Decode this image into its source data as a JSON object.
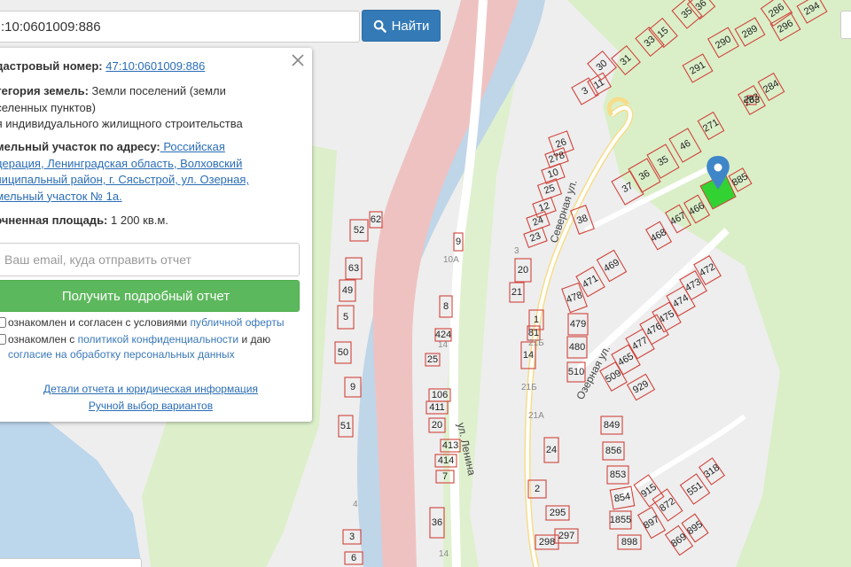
{
  "search": {
    "value": ":10:0601009:886",
    "button_label": "Найти"
  },
  "panel": {
    "cadastral_label": "адастровый номер:",
    "cadastral_value": "47:10:0601009:886",
    "category_label": "атегория земель:",
    "category_line1": " Земли поселений (земли",
    "category_line2": "аселенных пунктов)",
    "category_line3": "ля индивидуального жилищного строительства",
    "address_label": "емельный участок по адресу:",
    "address_line1": " Российская",
    "address_line2": "едерация, Ленинградская область, Волховский",
    "address_line3": "униципальный район, г. Сясьстрой, ул. Озерная,",
    "address_line4": "емельный участок № 1а.",
    "area_label": "точненная площадь:",
    "area_value": " 1 200 кв.м.",
    "email_placeholder": "Ваш email, куда отправить отчет",
    "report_button": "Получить подробный отчет",
    "consent1_prefix": "ознакомлен и согласен с условиями ",
    "consent1_link": "публичной оферты",
    "consent2_prefix": "ознакомлен с ",
    "consent2_link": "политикой конфиденциальности",
    "consent2_suffix": " и даю",
    "consent2_link2": "согласие на обработку персональных данных",
    "details_link": "Детали отчета и юридическая информация",
    "manual_link": "Ручной выбор вариантов"
  },
  "map": {
    "street_labels": [
      "Северная ул.",
      "Озерная ул.",
      "ул. Ленина"
    ],
    "faint_labels": [
      "21Б",
      "21А",
      "21Б",
      "10А",
      "14",
      "4",
      "3",
      "14"
    ],
    "parcel_labels": [
      "35",
      "36",
      "286",
      "294",
      "15",
      "33",
      "31",
      "30",
      "11",
      "290",
      "289",
      "291",
      "296",
      "3",
      "283",
      "284",
      "283",
      "271",
      "26",
      "278",
      "10",
      "25",
      "46",
      "35",
      "36",
      "37",
      "885",
      "12",
      "24",
      "23",
      "38",
      "467",
      "466",
      "468",
      "469",
      "472",
      "473",
      "62",
      "52",
      "63",
      "49",
      "9",
      "20",
      "21",
      "471",
      "478",
      "474",
      "475",
      "5",
      "8",
      "424",
      "479",
      "480",
      "476",
      "477",
      "465",
      "50",
      "25",
      "1",
      "14",
      "81",
      "510",
      "509",
      "929",
      "9",
      "106",
      "411",
      "413",
      "20",
      "51",
      "414",
      "7",
      "849",
      "856",
      "853",
      "854",
      "915",
      "1855",
      "872",
      "897",
      "898",
      "869",
      "895",
      "551",
      "318",
      "24",
      "2",
      "295",
      "298",
      "297",
      "36",
      "3",
      "6"
    ]
  },
  "colors": {
    "parcel_stroke": "#d0443c",
    "selected_parcel": "#32d232",
    "marker": "#3f86c8",
    "river": "#d8e4ee",
    "road": "#f1cbcb",
    "green_area": "#daefc8"
  }
}
